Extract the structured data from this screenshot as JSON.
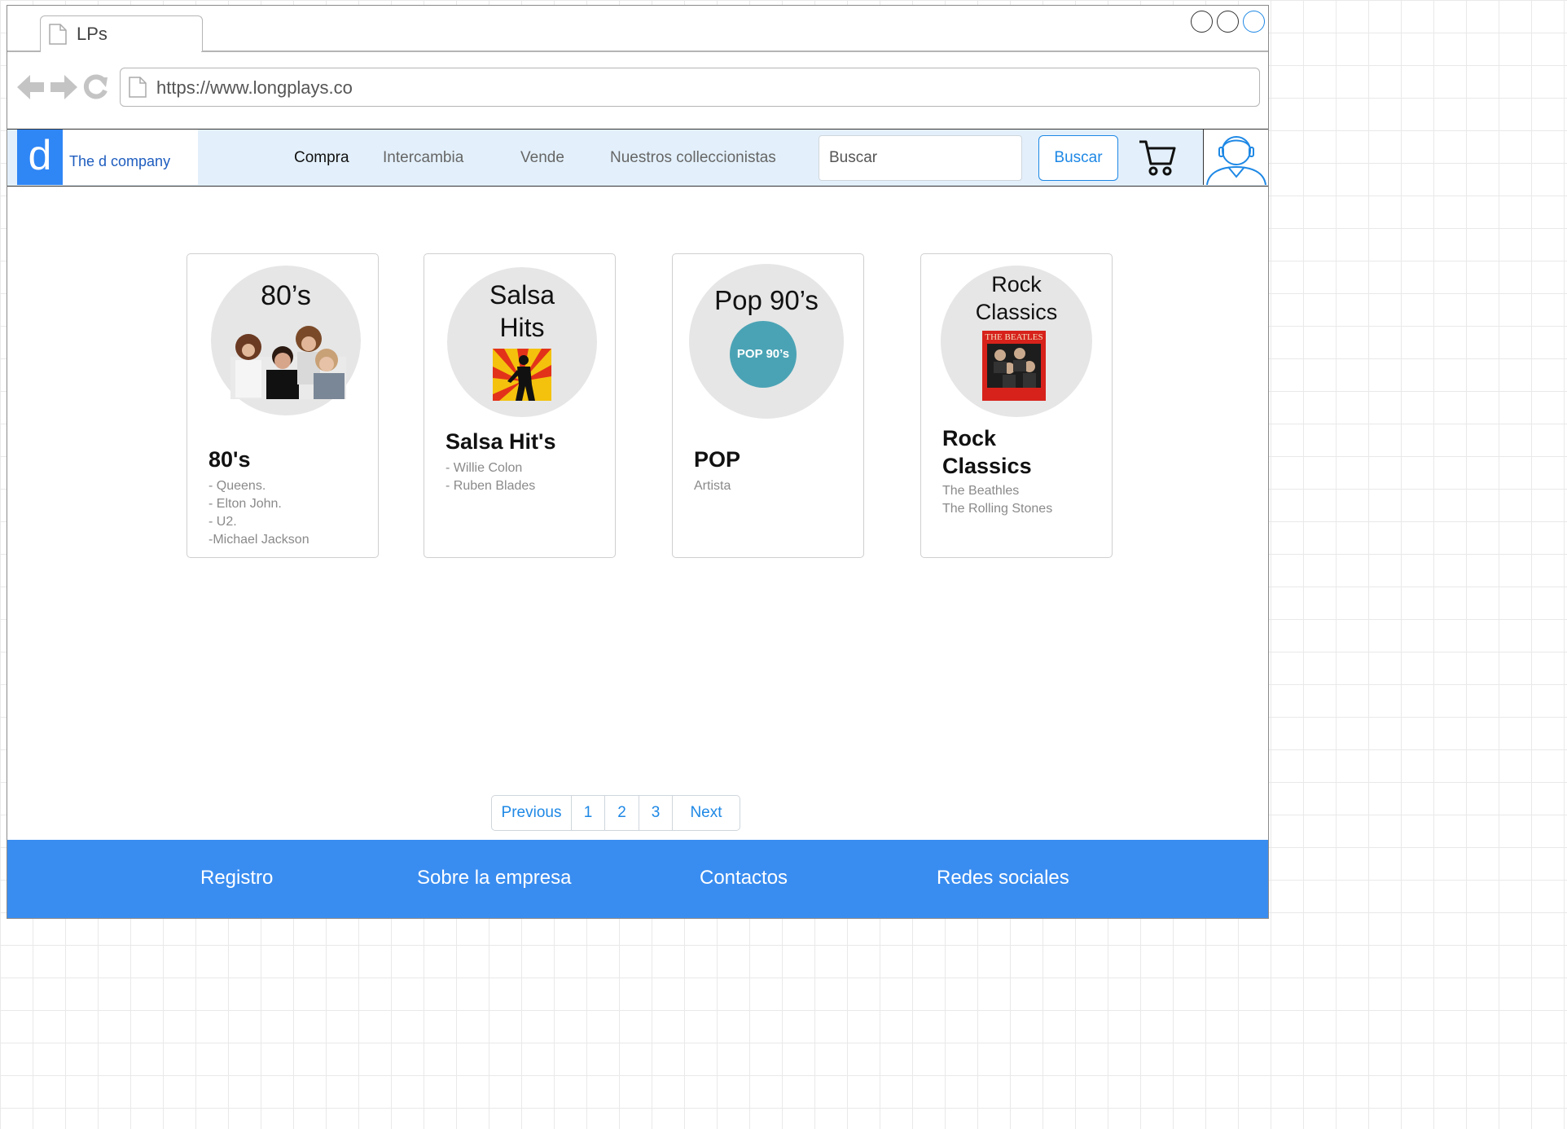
{
  "browser": {
    "tab_title": "LPs",
    "url": "https://www.longplays.co"
  },
  "header": {
    "brand_letter": "d",
    "brand_name": "The d company",
    "nav": [
      "Compra",
      "Intercambia",
      "Vende",
      "Nuestros colleccionistas"
    ],
    "active_nav": "Compra",
    "search_placeholder": "Buscar",
    "search_button": "Buscar"
  },
  "cards": [
    {
      "disc_label": "80’s",
      "title": "80's",
      "items": [
        "- Queens.",
        "- Elton John.",
        "- U2.",
        "-Michael Jackson"
      ]
    },
    {
      "disc_label_lines": [
        "Salsa",
        "Hits"
      ],
      "title": "Salsa Hit's",
      "items": [
        "- Willie Colon",
        "- Ruben Blades"
      ]
    },
    {
      "disc_label": "Pop 90’s",
      "badge": "POP 90’s",
      "title": "POP",
      "items": [
        "Artista"
      ]
    },
    {
      "disc_label_lines": [
        "Rock",
        "Classics"
      ],
      "album_text": "THE BEATLES",
      "title_lines": [
        "Rock",
        "Classics"
      ],
      "items": [
        "The Beathles",
        "The Rolling Stones"
      ]
    }
  ],
  "pagination": [
    "Previous",
    "1",
    "2",
    "3",
    "Next"
  ],
  "footer": [
    "Registro",
    "Sobre la empresa",
    "Contactos",
    "Redes sociales"
  ],
  "colors": {
    "accent": "#1e88e5",
    "brand": "#2f86f5",
    "footer": "#3a8df0",
    "nav_bg": "#e3f0fb",
    "badge": "#4aa3b5"
  },
  "icons": [
    "page-icon",
    "back-arrow-icon",
    "forward-arrow-icon",
    "reload-icon",
    "cart-icon",
    "user-avatar-icon"
  ]
}
